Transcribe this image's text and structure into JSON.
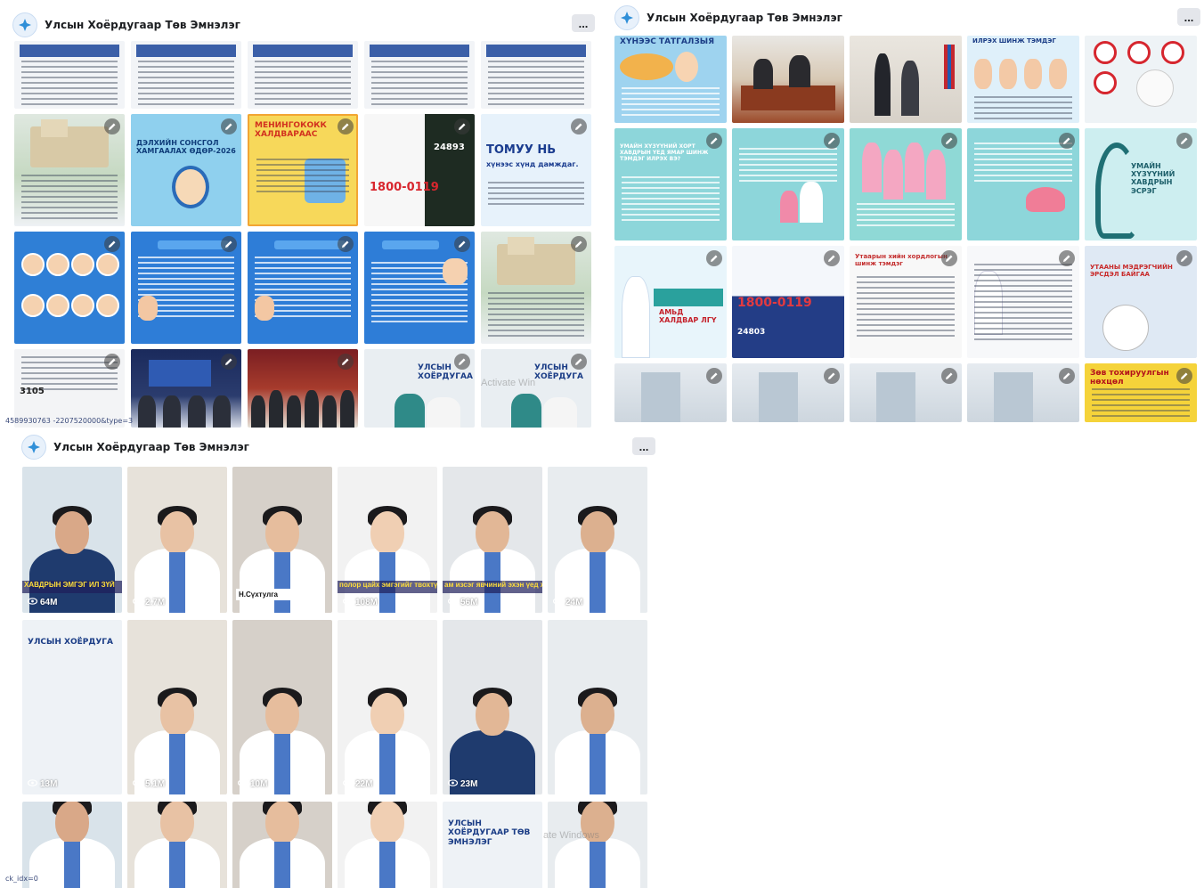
{
  "page_name": "Улсын Хоёрдугаар Төв Эмнэлэг",
  "more_label": "...",
  "colors": {
    "accent": "#2f8fd8",
    "teal": "#6fc9cf",
    "blue_poster": "#2e7dd7",
    "header_text": "#1c1e21"
  },
  "panel_a": {
    "tiles": [
      {
        "kind": "doc"
      },
      {
        "kind": "doc"
      },
      {
        "kind": "doc"
      },
      {
        "kind": "doc"
      },
      {
        "kind": "doc"
      },
      {
        "kind": "building"
      },
      {
        "kind": "poster_blue",
        "caption": "ДЭЛХИЙН СОНСГОЛ ХАМГААЛАХ ӨДӨР-2026"
      },
      {
        "kind": "poster_yellow",
        "caption": "МЕНИНГОКОКК ХАЛДВАРААС"
      },
      {
        "kind": "hotline_dark",
        "phone": "1800-0119",
        "number": "24893"
      },
      {
        "kind": "poster_light",
        "caption": "ТОМУУ НЬ",
        "subcaption": "хүнээс хүнд дамждаг."
      },
      {
        "kind": "poster_faces"
      },
      {
        "kind": "poster_blue2"
      },
      {
        "kind": "poster_blue2"
      },
      {
        "kind": "poster_blue3"
      },
      {
        "kind": "building"
      },
      {
        "kind": "doc_small",
        "number": "3105"
      },
      {
        "kind": "dark_event"
      },
      {
        "kind": "ceremony"
      },
      {
        "kind": "logo_people",
        "logo_text": "УЛСЫН ХОЁРДУГАА"
      },
      {
        "kind": "logo_people",
        "logo_text": "УЛСЫН ХОЁРДУГА"
      }
    ],
    "status_url": "4589930763 -2207520000&type=3",
    "watermark": "Activate Win"
  },
  "panel_b": {
    "tiles": [
      {
        "kind": "poster_cartoon",
        "caption": "ХҮНЭЭС ТАТГАЛЗЫЯ"
      },
      {
        "kind": "meeting"
      },
      {
        "kind": "office"
      },
      {
        "kind": "kids_poster",
        "caption": "ИЛРЭХ ШИНЖ ТЭМДЭГ"
      },
      {
        "kind": "signs_poster"
      },
      {
        "kind": "teal_text",
        "caption": "УМАЙН ХҮЗҮҮНИЙ ХОРТ ХАВДРЫН ҮЕД ЯМАР ШИНЖ ТЭМДЭГ ИЛРЭХ ВЭ?"
      },
      {
        "kind": "teal_people"
      },
      {
        "kind": "teal_women"
      },
      {
        "kind": "teal_uterus"
      },
      {
        "kind": "teal_ribbon",
        "caption": "УМАЙН ХҮЗҮҮНИЙ ХАВДРЫН ЭСРЭГ"
      },
      {
        "kind": "nurse_poster",
        "caption": "АМЬД ХАЛДВАР ЛГҮ"
      },
      {
        "kind": "hotline_blue",
        "phone": "1800-0119",
        "number": "24803"
      },
      {
        "kind": "doc_drugs",
        "caption": "Утаарын хийн хордлогын шинж тэмдэг"
      },
      {
        "kind": "doctor_doc"
      },
      {
        "kind": "device_poster",
        "caption": "УТААНЫ МЭДРЭГЧИЙН ЭРСДЭЛ БАЙГАА"
      },
      {
        "kind": "corridor"
      },
      {
        "kind": "corridor"
      },
      {
        "kind": "corridor"
      },
      {
        "kind": "corridor"
      },
      {
        "kind": "yellow_notice",
        "caption": "Зөв тохируулгын нөхцөл"
      }
    ]
  },
  "panel_c": {
    "tiles": [
      {
        "views": "64M",
        "overlay": "ХАВДРЫН ЭМГЭГ ИЛ ЗҮЙ"
      },
      {
        "views": "2.7M"
      },
      {
        "views": "",
        "name": "Н.Сүхтулга"
      },
      {
        "views": "108M",
        "overlay": "полор цайх эмгэгийг твохтүй"
      },
      {
        "views": "56M",
        "overlay": "ам изсэг явчиний эхэн үед харва"
      },
      {
        "views": "24M"
      },
      {
        "views": "13M",
        "logo_text": "УЛСЫН ХОЁРДУГА"
      },
      {
        "views": "5.1M"
      },
      {
        "views": "10M"
      },
      {
        "views": "22M"
      },
      {
        "views": "23M"
      },
      {
        "views": ""
      },
      {
        "views": ""
      },
      {
        "views": ""
      },
      {
        "views": ""
      },
      {
        "views": ""
      },
      {
        "views": "",
        "logo_text": "УЛСЫН ХОЁРДУГААР ТӨВ ЭМНЭЛЭГ"
      },
      {
        "views": ""
      }
    ],
    "status_url": "ck_idx=0",
    "watermark": "ate Windows"
  }
}
